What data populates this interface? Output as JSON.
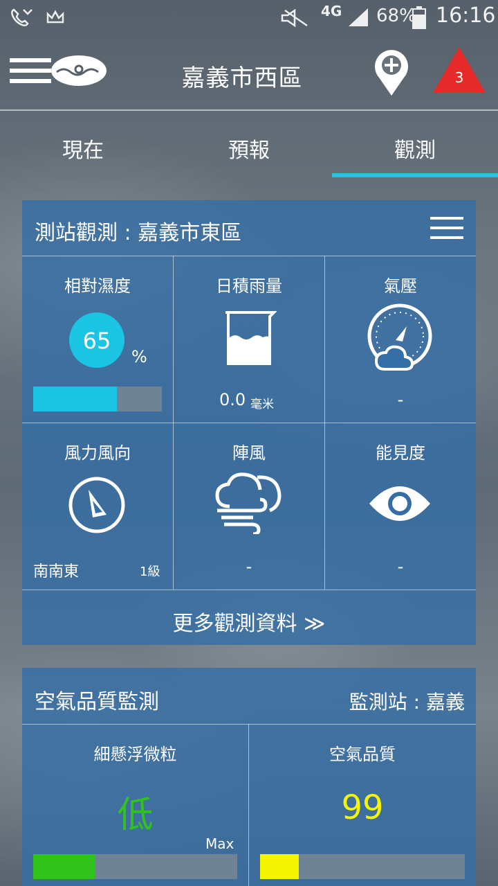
{
  "status_bar": {
    "network": "4G",
    "battery": "68%",
    "time": "16:16",
    "icons": [
      "phone-missed-icon",
      "crown-icon",
      "mute-icon",
      "signal-icon",
      "battery-icon"
    ]
  },
  "header": {
    "location": "嘉義市西區",
    "alert_count": "3",
    "icons": [
      "menu-icon",
      "logo-icon",
      "add-location-icon",
      "warning-icon"
    ]
  },
  "tabs": [
    {
      "label": "現在",
      "active": false
    },
    {
      "label": "預報",
      "active": false
    },
    {
      "label": "觀測",
      "active": true
    }
  ],
  "observation": {
    "title": "測站觀測 : 嘉義市東區",
    "humidity": {
      "label": "相對濕度",
      "value": "65",
      "unit": "%",
      "level": 0.65,
      "bar_color": "#1cc4e3"
    },
    "rain": {
      "label": "日積雨量",
      "value": "0.0",
      "unit": "毫米"
    },
    "pressure": {
      "label": "氣壓",
      "value": "-"
    },
    "wind": {
      "label": "風力風向",
      "direction": "南南東",
      "force": "1級"
    },
    "gust": {
      "label": "陣風",
      "value": "-"
    },
    "visibility": {
      "label": "能見度",
      "value": "-"
    },
    "more": "更多觀測資料 ≫"
  },
  "air_quality": {
    "title": "空氣品質監測",
    "station": "監測站 : 嘉義",
    "pm": {
      "label": "細懸浮微粒",
      "value": "低",
      "color": "#32c21c",
      "max_label": "Max",
      "level": 0.3
    },
    "aqi": {
      "label": "空氣品質",
      "value": "99",
      "color": "#f5f500",
      "level": 0.19
    }
  }
}
